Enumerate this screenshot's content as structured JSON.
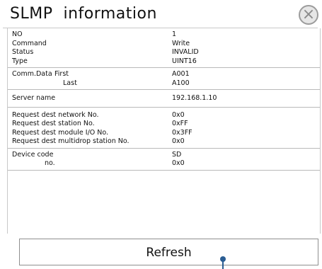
{
  "window": {
    "title": "SLMP  information",
    "close_icon": "×"
  },
  "info": {
    "no_label": "NO",
    "no_value": "1",
    "command_label": "Command",
    "command_value": "Write",
    "status_label": "Status",
    "status_value": "INVALID",
    "type_label": "Type",
    "type_value": "UINT16",
    "comm_label": "Comm.Data",
    "first_label": "First",
    "first_value": "A001",
    "last_label": "Last",
    "last_value": "A100",
    "server_label": "Server name",
    "server_value": "192.168.1.10",
    "req_network_label": "Request dest network No.",
    "req_network_value": "0x0",
    "req_station_label": "Request dest station No.",
    "req_station_value": "0xFF",
    "req_module_label": "Request dest module I/O No.",
    "req_module_value": "0x3FF",
    "req_multidrop_label": "Request dest multidrop station No.",
    "req_multidrop_value": "0x0",
    "device_code_label": "Device code",
    "device_code_value": "SD",
    "device_no_label": "no.",
    "device_no_value": "0x0"
  },
  "refresh_label": "Refresh"
}
